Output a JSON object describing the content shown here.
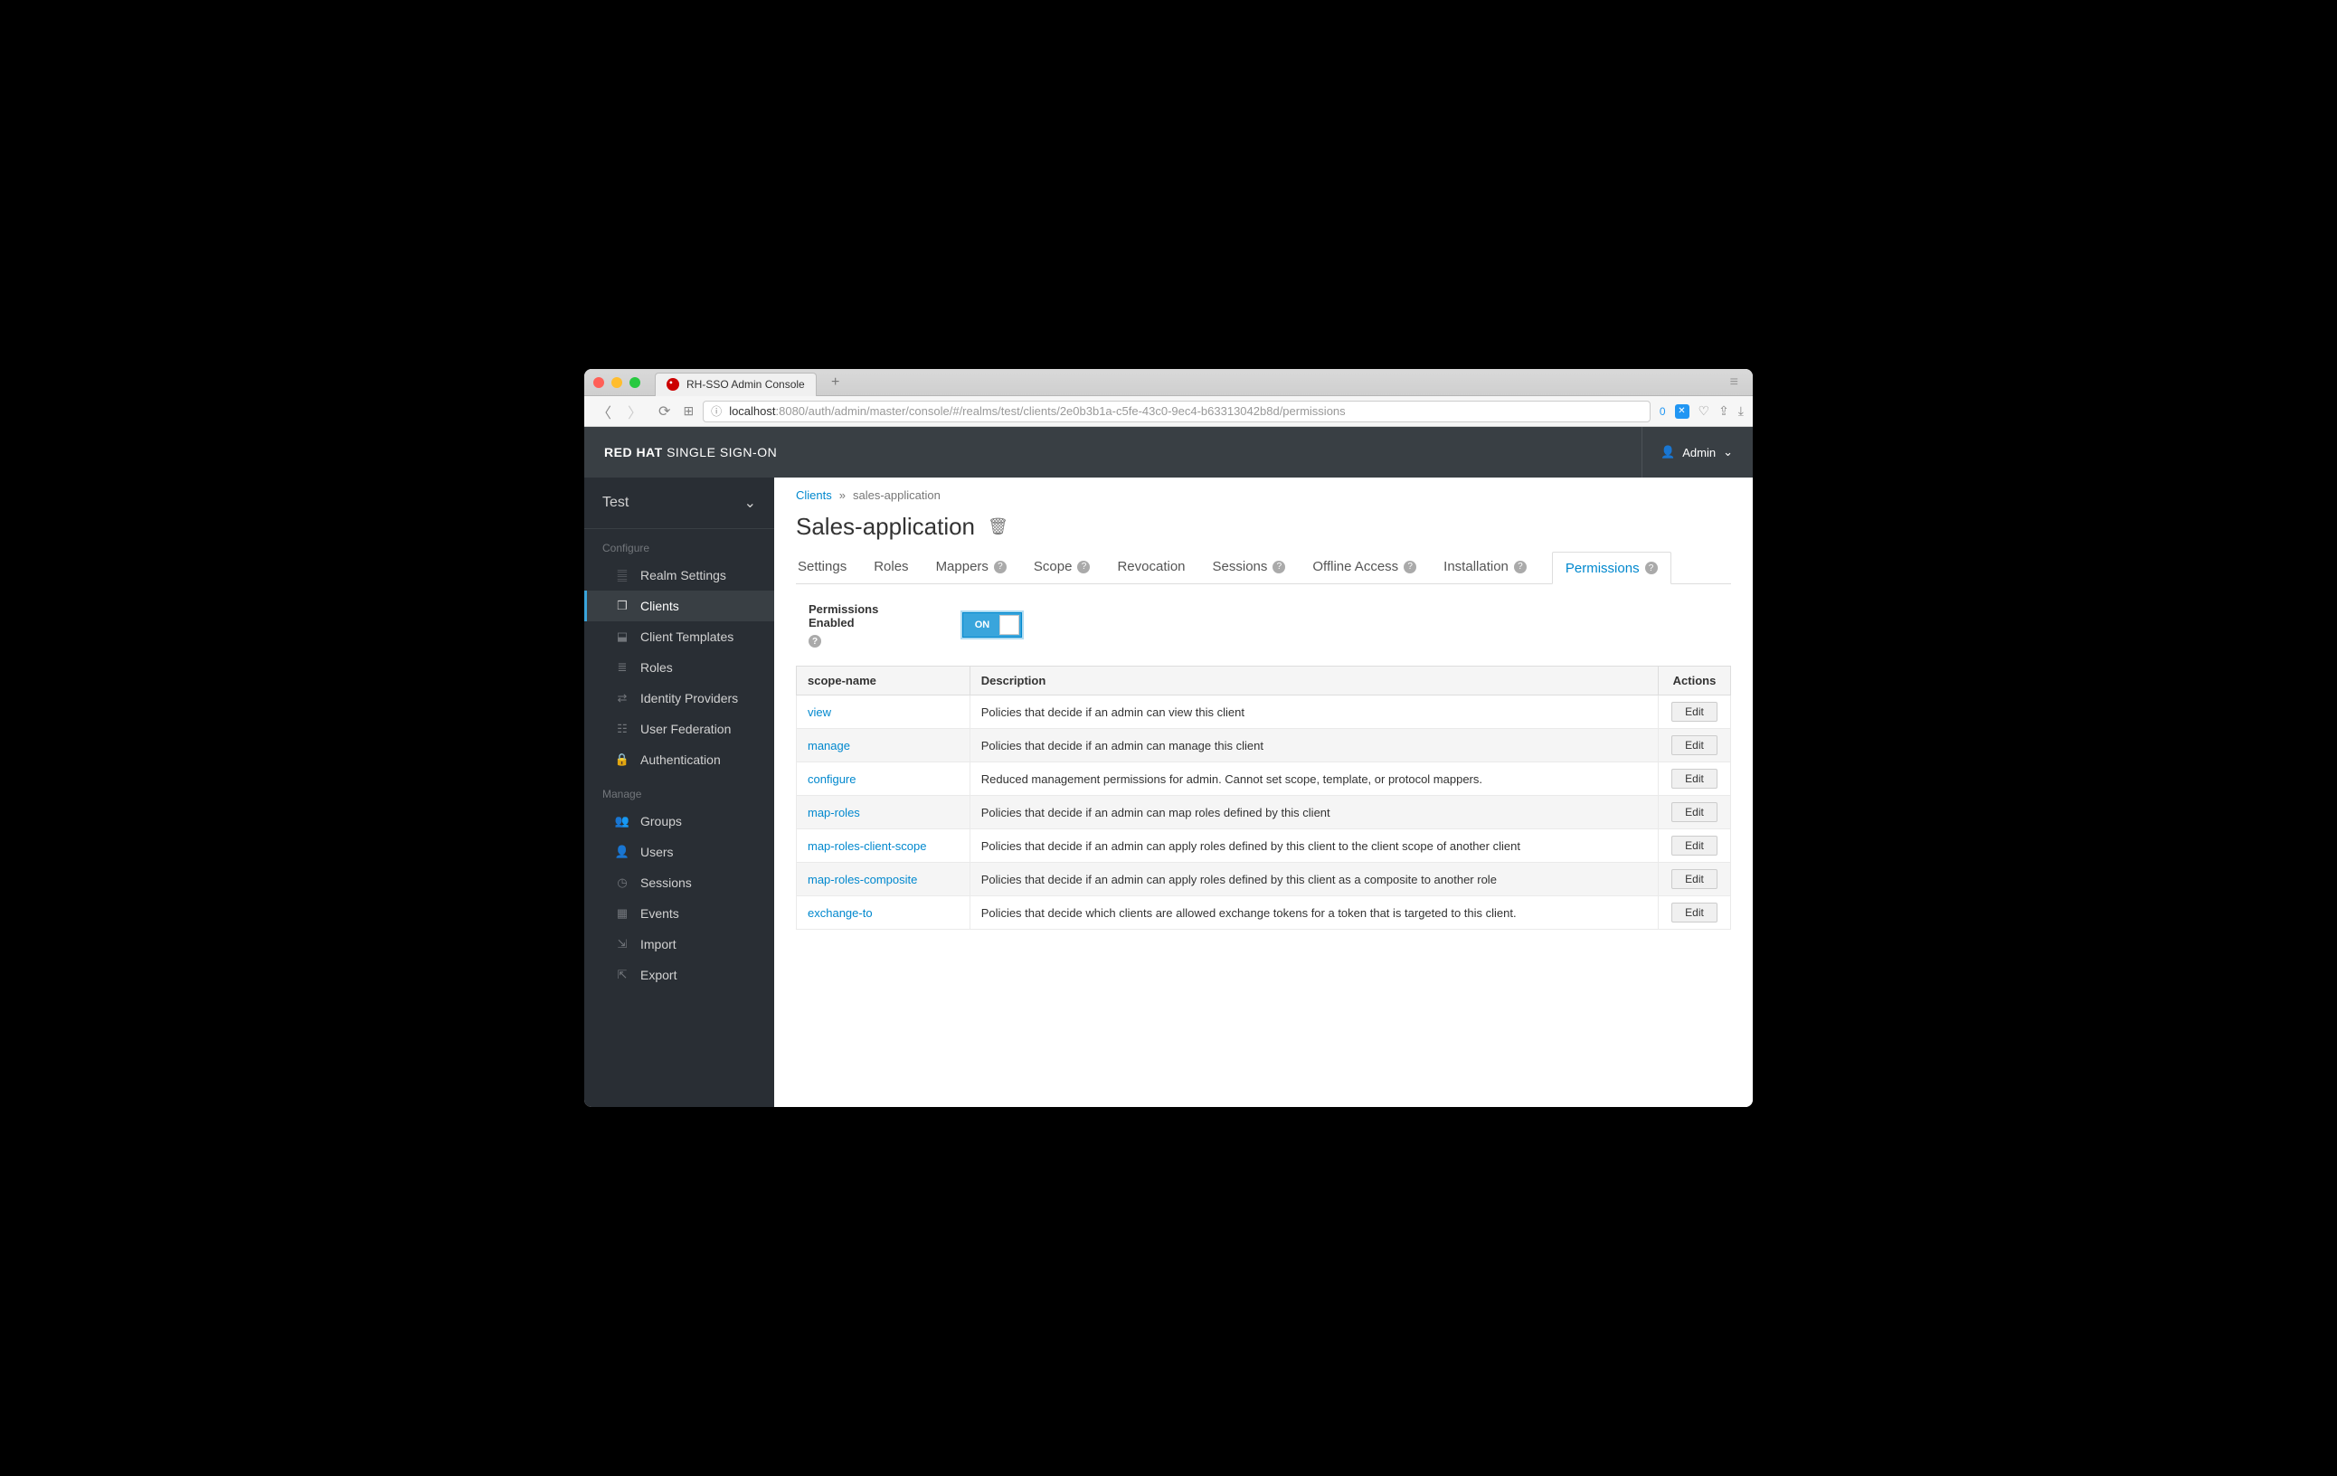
{
  "browser": {
    "tab_title": "RH-SSO Admin Console",
    "url_host": "localhost",
    "url_rest": ":8080/auth/admin/master/console/#/realms/test/clients/2e0b3b1a-c5fe-43c0-9ec4-b63313042b8d/permissions",
    "tab_count": "0"
  },
  "header": {
    "brand_bold": "RED HAT",
    "brand_rest": "SINGLE SIGN-ON",
    "user": "Admin"
  },
  "sidebar": {
    "realm": "Test",
    "section_configure": "Configure",
    "section_manage": "Manage",
    "configure_items": [
      {
        "label": "Realm Settings",
        "icon": "sliders"
      },
      {
        "label": "Clients",
        "icon": "cube",
        "active": true
      },
      {
        "label": "Client Templates",
        "icon": "cubes"
      },
      {
        "label": "Roles",
        "icon": "list"
      },
      {
        "label": "Identity Providers",
        "icon": "exchange"
      },
      {
        "label": "User Federation",
        "icon": "database"
      },
      {
        "label": "Authentication",
        "icon": "lock"
      }
    ],
    "manage_items": [
      {
        "label": "Groups",
        "icon": "users"
      },
      {
        "label": "Users",
        "icon": "user"
      },
      {
        "label": "Sessions",
        "icon": "clock"
      },
      {
        "label": "Events",
        "icon": "calendar"
      },
      {
        "label": "Import",
        "icon": "import"
      },
      {
        "label": "Export",
        "icon": "export"
      }
    ]
  },
  "breadcrumb": {
    "root": "Clients",
    "current": "sales-application"
  },
  "page_title": "Sales-application",
  "tabs": [
    {
      "label": "Settings",
      "help": false
    },
    {
      "label": "Roles",
      "help": false
    },
    {
      "label": "Mappers",
      "help": true
    },
    {
      "label": "Scope",
      "help": true
    },
    {
      "label": "Revocation",
      "help": false
    },
    {
      "label": "Sessions",
      "help": true
    },
    {
      "label": "Offline Access",
      "help": true
    },
    {
      "label": "Installation",
      "help": true
    },
    {
      "label": "Permissions",
      "help": true,
      "active": true
    }
  ],
  "form": {
    "permissions_enabled_label": "Permissions Enabled",
    "toggle_on_label": "ON"
  },
  "table": {
    "headers": {
      "scope": "scope-name",
      "desc": "Description",
      "actions": "Actions"
    },
    "edit_label": "Edit",
    "rows": [
      {
        "scope": "view",
        "desc": "Policies that decide if an admin can view this client"
      },
      {
        "scope": "manage",
        "desc": "Policies that decide if an admin can manage this client"
      },
      {
        "scope": "configure",
        "desc": "Reduced management permissions for admin. Cannot set scope, template, or protocol mappers."
      },
      {
        "scope": "map-roles",
        "desc": "Policies that decide if an admin can map roles defined by this client"
      },
      {
        "scope": "map-roles-client-scope",
        "desc": "Policies that decide if an admin can apply roles defined by this client to the client scope of another client"
      },
      {
        "scope": "map-roles-composite",
        "desc": "Policies that decide if an admin can apply roles defined by this client as a composite to another role"
      },
      {
        "scope": "exchange-to",
        "desc": "Policies that decide which clients are allowed exchange tokens for a token that is targeted to this client."
      }
    ]
  }
}
